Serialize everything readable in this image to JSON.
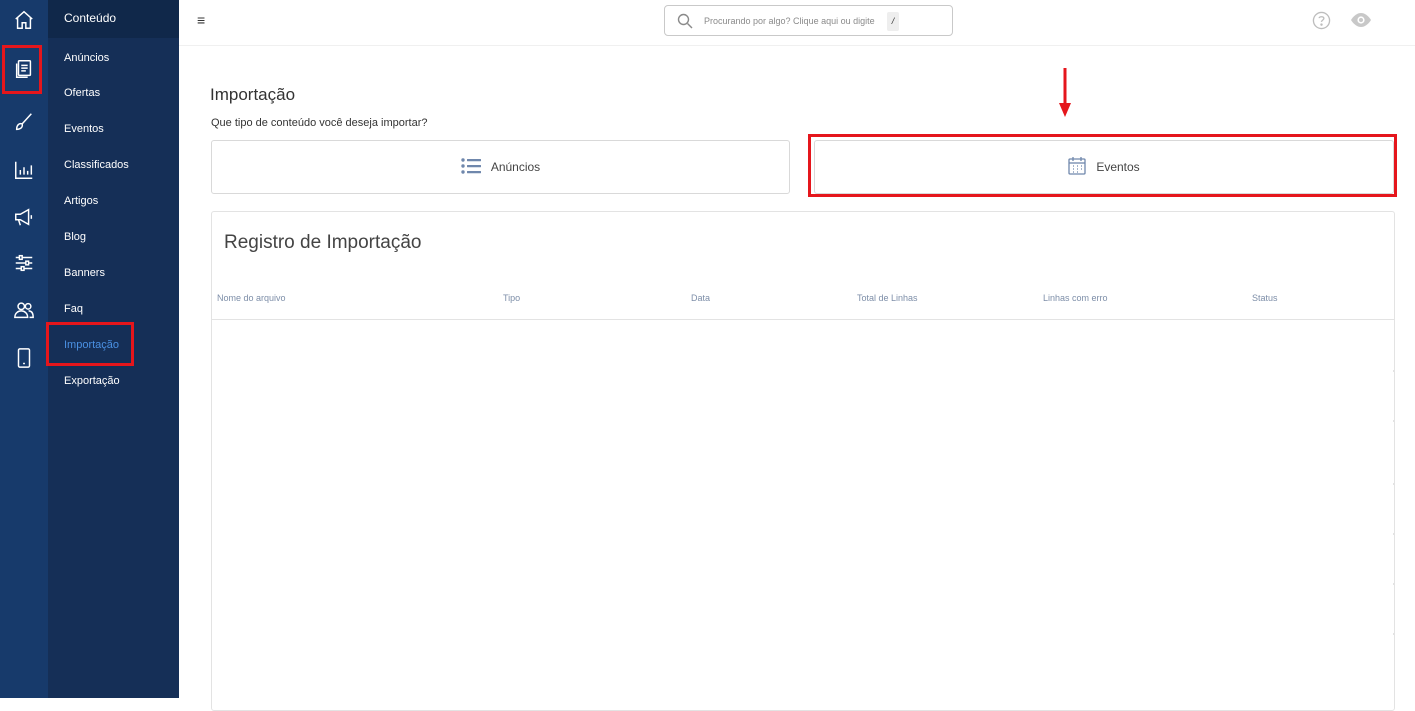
{
  "rail": {
    "icons": [
      "home-icon",
      "content-icon",
      "brush-icon",
      "chart-icon",
      "megaphone-icon",
      "sliders-icon",
      "users-icon",
      "mobile-icon"
    ]
  },
  "sidebar": {
    "header": "Conteúdo",
    "items": [
      {
        "label": "Anúncios"
      },
      {
        "label": "Ofertas"
      },
      {
        "label": "Eventos"
      },
      {
        "label": "Classificados"
      },
      {
        "label": "Artigos"
      },
      {
        "label": "Blog"
      },
      {
        "label": "Banners"
      },
      {
        "label": "Faq"
      },
      {
        "label": "Importação",
        "active": true
      },
      {
        "label": "Exportação"
      }
    ]
  },
  "topbar": {
    "menu_icon": "≡",
    "search_placeholder": "Procurando por algo? Clique aqui ou digite",
    "search_shortcut": "/"
  },
  "main": {
    "title": "Importação",
    "question": "Que tipo de conteúdo você deseja importar?",
    "options": [
      {
        "label": "Anúncios",
        "icon": "list-icon"
      },
      {
        "label": "Eventos",
        "icon": "calendar-icon"
      }
    ],
    "registry": {
      "title": "Registro de Importação",
      "columns": [
        "Nome do arquivo",
        "Tipo",
        "Data",
        "Total de Linhas",
        "Linhas com erro",
        "Status"
      ]
    }
  },
  "colors": {
    "rail_bg": "#173a6b",
    "sidebar_bg": "#152f57",
    "active_link": "#4a90e2",
    "highlight": "#e5161c",
    "icon_blue": "#6f87ac"
  }
}
